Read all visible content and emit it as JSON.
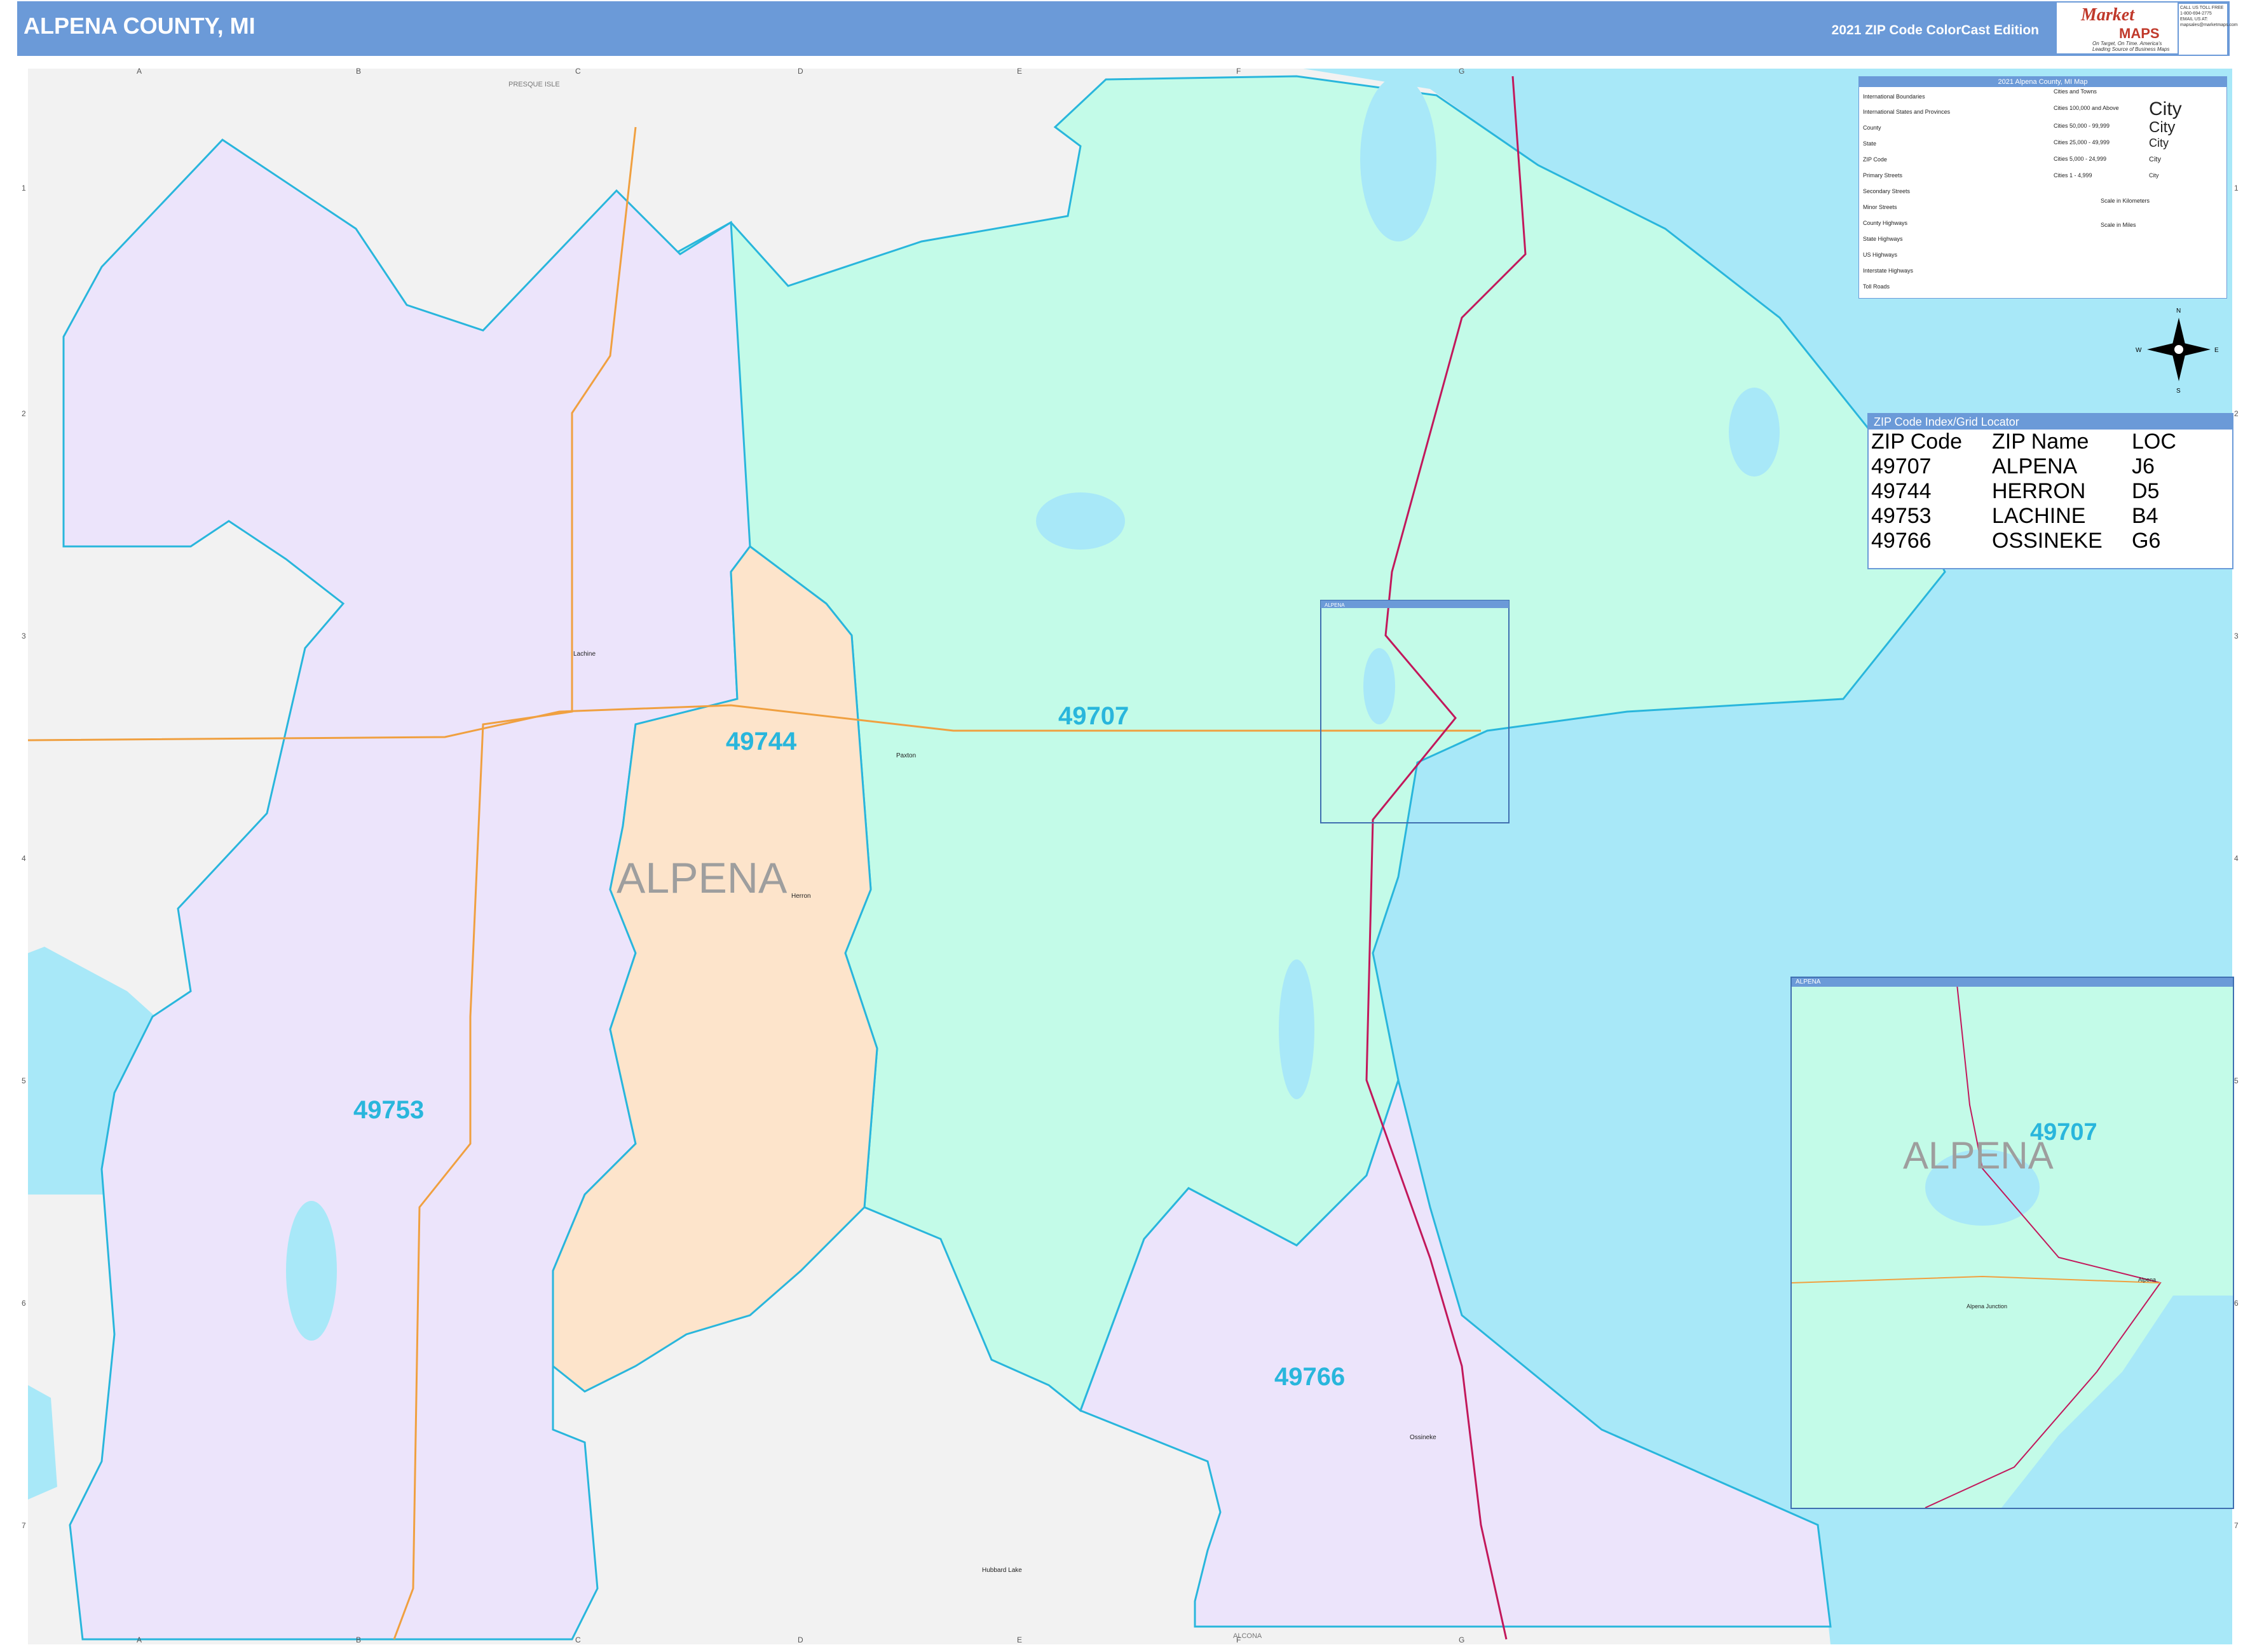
{
  "header": {
    "title": "ALPENA COUNTY, MI",
    "edition": "2021 ZIP Code ColorCast Edition",
    "logo_market": "Market",
    "logo_maps": "MAPS",
    "logo_tagline": "On Target, On Time. America's Leading Source of Business Maps",
    "contact": "CALL US TOLL FREE 1-800-694-2775 EMAIL US AT: mapsales@marketmaps.com"
  },
  "grid": {
    "columns": [
      "A",
      "B",
      "C",
      "D",
      "E",
      "F",
      "G"
    ],
    "rows": [
      "1",
      "2",
      "3",
      "4",
      "5",
      "6",
      "7"
    ]
  },
  "map": {
    "county_label": "ALPENA",
    "adjacent_north": "PRESQUE ISLE",
    "adjacent_south": "ALCONA",
    "inset_box_label": "ALPENA",
    "colors": {
      "water": "#a8e8f8",
      "zip_49707": "#c3fbe8",
      "zip_49753": "#ece4fb",
      "zip_49744": "#fde4cb",
      "zip_49766": "#ece4fb",
      "outside": "#f2f2f2",
      "zip_border": "#29b6dc",
      "zip_label": "#29b6dc",
      "us_highway": "#c2185b",
      "state_highway": "#f0a040"
    },
    "zips": [
      {
        "code": "49707"
      },
      {
        "code": "49744"
      },
      {
        "code": "49753"
      },
      {
        "code": "49766"
      }
    ],
    "places": [
      "Lachine",
      "Paxton",
      "Herron",
      "Ossineke",
      "Hubbard Lake"
    ]
  },
  "legend": {
    "title": "2021 Alpena County, MI Map",
    "items": [
      "International Boundaries",
      "International States and Provinces",
      "County",
      "State",
      "ZIP Code",
      "Primary Streets",
      "Secondary Streets",
      "Minor Streets",
      "County Highways",
      "State Highways",
      "US Highways",
      "Interstate Highways",
      "Toll Roads"
    ],
    "cities_heading": "Cities and Towns",
    "city_sizes": [
      {
        "range": "Cities 100,000 and Above",
        "sample": "City"
      },
      {
        "range": "Cities 50,000 - 99,999",
        "sample": "City"
      },
      {
        "range": "Cities 25,000 - 49,999",
        "sample": "City"
      },
      {
        "range": "Cities 5,000 - 24,999",
        "sample": "City"
      },
      {
        "range": "Cities 1 - 4,999",
        "sample": "City"
      }
    ],
    "scale_km": "Scale in Kilometers",
    "scale_mi": "Scale in Miles"
  },
  "compass": {
    "n": "N",
    "s": "S",
    "e": "E",
    "w": "W"
  },
  "zip_index": {
    "title": "ZIP Code Index/Grid Locator",
    "headers": [
      "ZIP Code",
      "ZIP Name",
      "LOC"
    ],
    "rows": [
      [
        "49707",
        "ALPENA",
        "J6"
      ],
      [
        "49744",
        "HERRON",
        "D5"
      ],
      [
        "49753",
        "LACHINE",
        "B4"
      ],
      [
        "49766",
        "OSSINEKE",
        "G6"
      ]
    ]
  },
  "inset": {
    "header": "ALPENA",
    "zip_label": "49707",
    "city_label": "ALPENA",
    "places": [
      "Alpena",
      "Alpena Junction"
    ]
  }
}
